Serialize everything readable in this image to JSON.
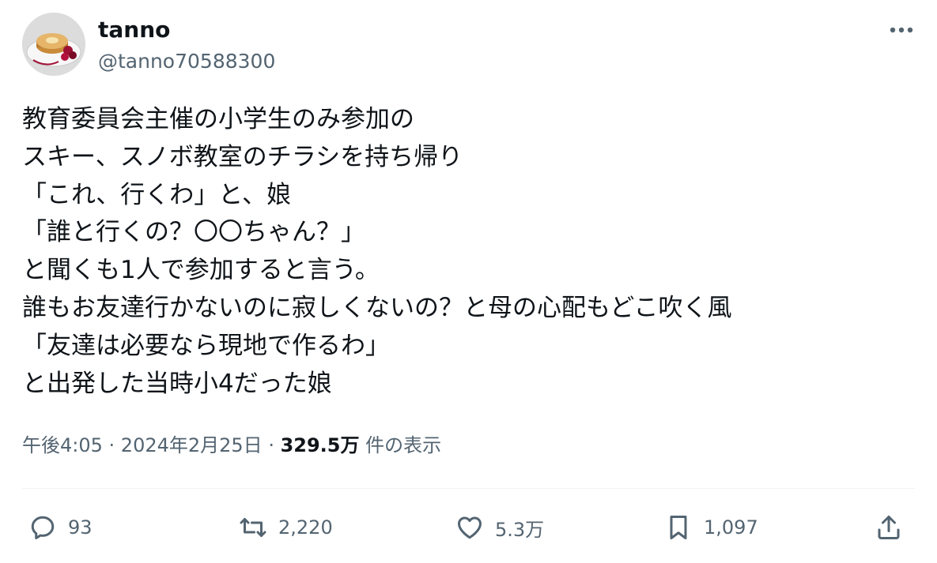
{
  "user": {
    "display_name": "tanno",
    "handle": "@tanno70588300",
    "avatar_icon": "pancake-avatar"
  },
  "menu": {
    "more_icon": "more-horizontal-icon"
  },
  "tweet": {
    "lines": [
      "教育委員会主催の小学生のみ参加の",
      "スキー、スノボ教室のチラシを持ち帰り",
      "「これ、行くわ」と、娘",
      "「誰と行くの？〇〇ちゃん？」",
      "と聞くも1人で参加すると言う。",
      "誰もお友達行かないのに寂しくないの？と母の心配もどこ吹く風",
      "「友達は必要なら現地で作るわ」",
      "と出発した当時小4だった娘"
    ]
  },
  "meta": {
    "time": "午後4:05",
    "sep1": " · ",
    "date": "2024年2月25日",
    "sep2": " · ",
    "views_count": "329.5万",
    "views_label": " 件の表示"
  },
  "actions": {
    "reply_count": "93",
    "retweet_count": "2,220",
    "like_count": "5.3万",
    "bookmark_count": "1,097"
  },
  "colors": {
    "text": "#0f1419",
    "secondary": "#536471",
    "divider": "#eff3f4"
  }
}
